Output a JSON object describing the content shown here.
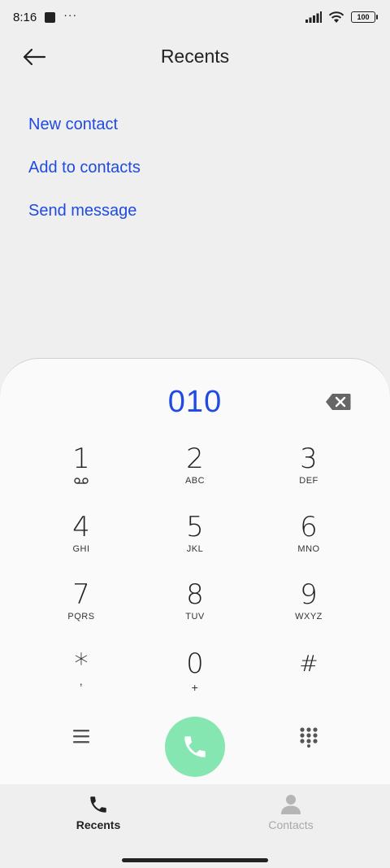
{
  "status_bar": {
    "time": "8:16",
    "dots": "···",
    "battery": "100"
  },
  "header": {
    "title": "Recents",
    "back_icon": "arrow-left-icon"
  },
  "actions": [
    {
      "label": "New contact"
    },
    {
      "label": "Add to contacts"
    },
    {
      "label": "Send message"
    }
  ],
  "dialer": {
    "number": "010",
    "keys": [
      {
        "digit": "1",
        "sub": ""
      },
      {
        "digit": "2",
        "sub": "ABC"
      },
      {
        "digit": "3",
        "sub": "DEF"
      },
      {
        "digit": "4",
        "sub": "GHI"
      },
      {
        "digit": "5",
        "sub": "JKL"
      },
      {
        "digit": "6",
        "sub": "MNO"
      },
      {
        "digit": "7",
        "sub": "PQRS"
      },
      {
        "digit": "8",
        "sub": "TUV"
      },
      {
        "digit": "9",
        "sub": "WXYZ"
      },
      {
        "digit": "*",
        "sub": ","
      },
      {
        "digit": "0",
        "sub": "+"
      },
      {
        "digit": "#",
        "sub": ""
      }
    ]
  },
  "bottom_nav": {
    "recents_label": "Recents",
    "contacts_label": "Contacts"
  },
  "colors": {
    "accent": "#1f4be0",
    "call_button": "#85e6b2",
    "background": "#efefef",
    "dialer_bg": "#fafafa"
  }
}
